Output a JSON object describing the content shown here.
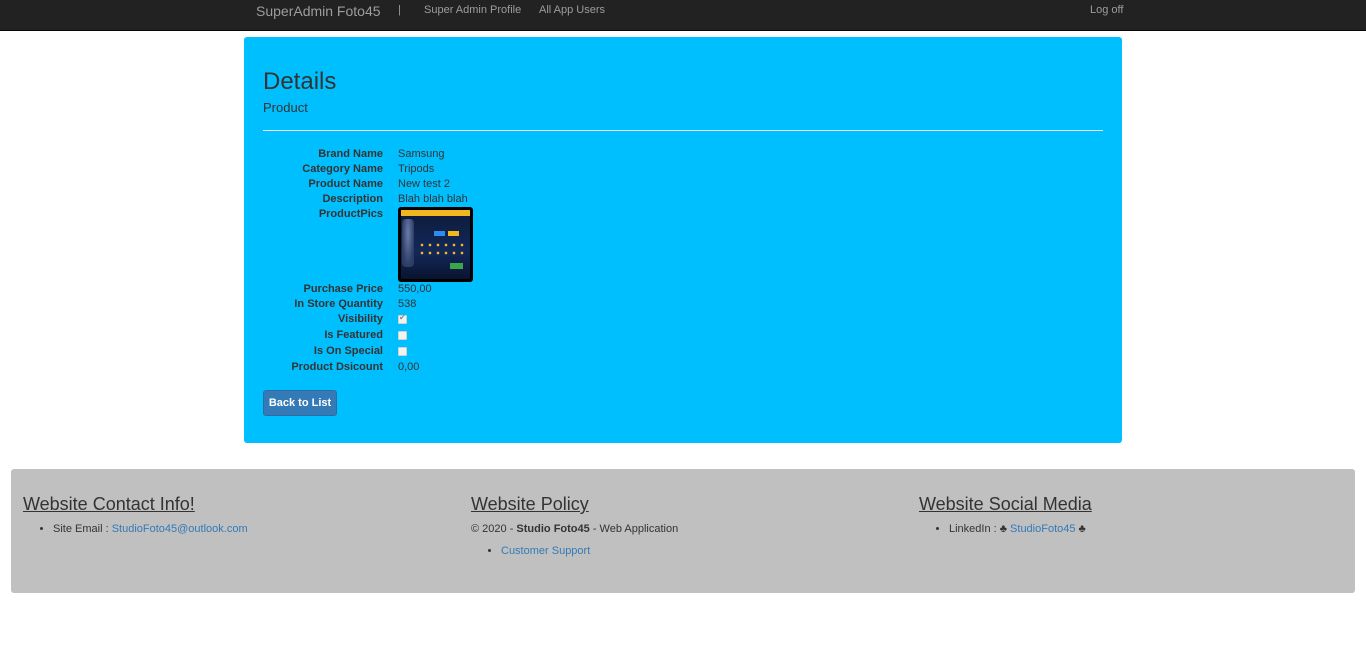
{
  "navbar": {
    "brand": "SuperAdmin Foto45",
    "separator": "|",
    "links": [
      "Super Admin Profile",
      "All App Users"
    ],
    "logoff": "Log off"
  },
  "page": {
    "title": "Details",
    "subtitle": "Product"
  },
  "details": {
    "brand_label": "Brand Name",
    "brand_value": "Samsung",
    "category_label": "Category Name",
    "category_value": "Tripods",
    "product_label": "Product Name",
    "product_value": "New test 2",
    "description_label": "Description",
    "description_value": "Blah blah blah",
    "pics_label": "ProductPics",
    "price_label": "Purchase Price",
    "price_value": "550,00",
    "quantity_label": "In Store Quantity",
    "quantity_value": "538",
    "visibility_label": "Visibility",
    "visibility_checked": true,
    "featured_label": "Is Featured",
    "featured_checked": false,
    "special_label": "Is On Special",
    "special_checked": false,
    "discount_label": "Product Dsicount",
    "discount_value": "0,00"
  },
  "actions": {
    "back_label": "Back to List"
  },
  "footer": {
    "contact": {
      "heading": "Website Contact Info!",
      "email_label": "Site Email :",
      "email_value": "StudioFoto45@outlook.com"
    },
    "policy": {
      "heading": "Website Policy",
      "copyright_prefix": "© 2020 -",
      "company": "Studio Foto45",
      "copyright_suffix": "- Web Application",
      "support_link": "Customer Support"
    },
    "social": {
      "heading": "Website Social Media",
      "linkedin_label": "LinkedIn :",
      "club": "♣",
      "linkedin_value": "StudioFoto45"
    }
  },
  "colors": {
    "navbar": "#222222",
    "panel": "#00bfff",
    "button": "#337ab7",
    "footer": "#c0c0c0"
  }
}
